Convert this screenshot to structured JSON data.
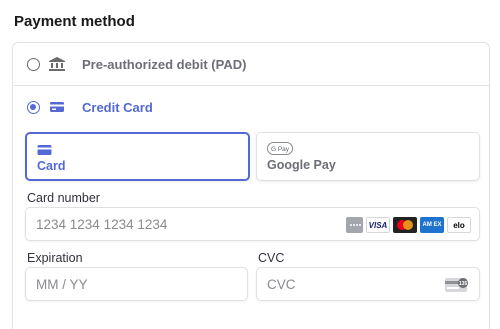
{
  "section": {
    "title": "Payment method"
  },
  "options": {
    "pad": {
      "label": "Pre-authorized debit (PAD)",
      "icon": "bank-icon"
    },
    "credit_card": {
      "label": "Credit Card",
      "icon": "credit-card-icon"
    }
  },
  "tabs": {
    "card": {
      "label": "Card",
      "icon": "credit-card-icon"
    },
    "google_pay": {
      "label": "Google Pay",
      "icon": "google-pay-icon",
      "badge": "G Pay"
    }
  },
  "fields": {
    "card_number": {
      "label": "Card number",
      "placeholder": "1234 1234 1234 1234"
    },
    "expiration": {
      "label": "Expiration",
      "placeholder": "MM / YY"
    },
    "cvc": {
      "label": "CVC",
      "placeholder": "CVC",
      "badge": "135"
    }
  },
  "brands": {
    "visa": "VISA",
    "amex": "AM EX",
    "elo": "elo"
  },
  "colors": {
    "accent": "#5469d4",
    "muted": "#6d6e78",
    "border": "#e0e0e0"
  }
}
